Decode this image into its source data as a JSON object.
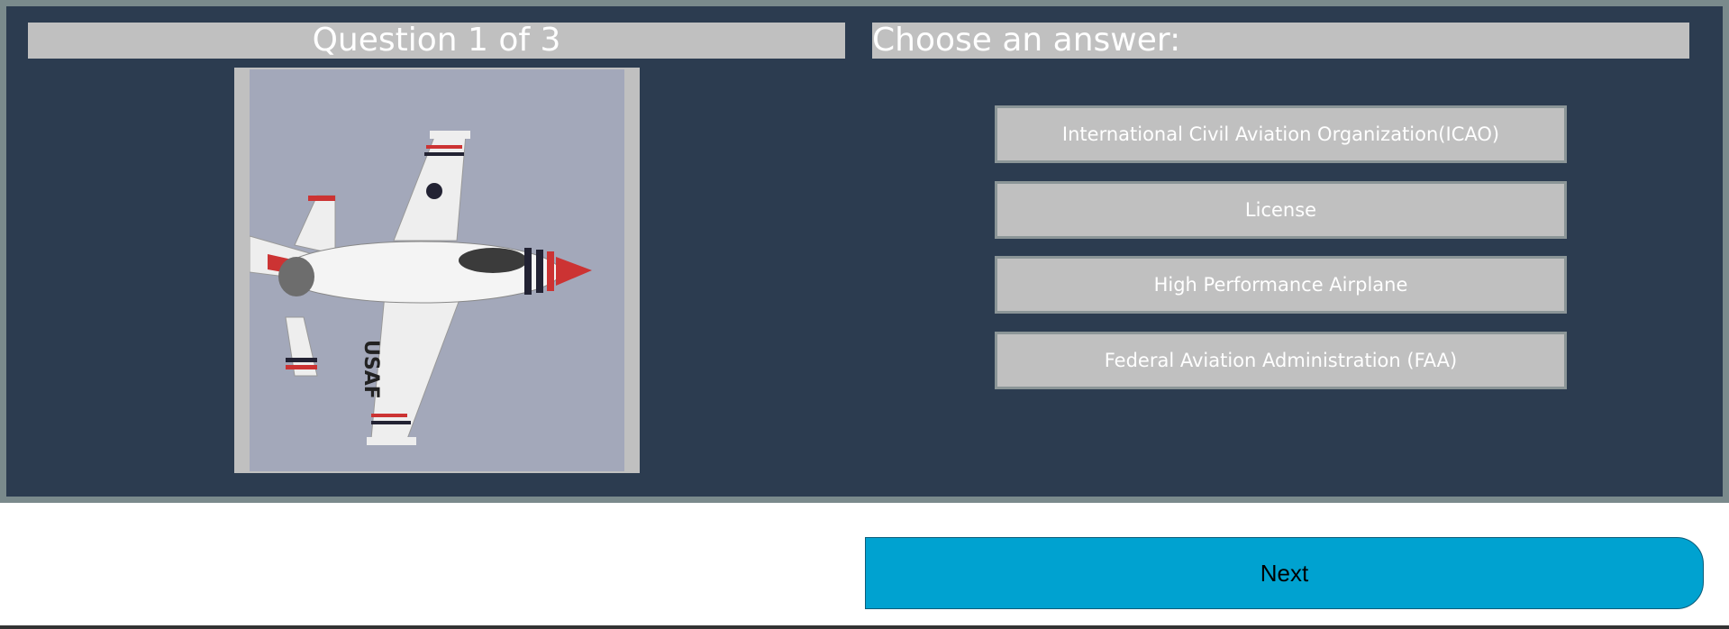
{
  "question": {
    "counter": "Question 1 of 3",
    "image": {
      "icon": "fighter-jet-image",
      "fuselage_text": "USAF"
    }
  },
  "answers": {
    "heading": "Choose an answer:",
    "options": [
      {
        "label": "International Civil Aviation Organization(ICAO)"
      },
      {
        "label": "License"
      },
      {
        "label": "High Performance Airplane"
      },
      {
        "label": "Federal Aviation Administration (FAA)"
      }
    ]
  },
  "navigation": {
    "next_label": "Next"
  },
  "colors": {
    "panel": "#2c3c50",
    "panel_border": "#7a8a8c",
    "option": "#c0c0c0",
    "next": "#00a2d0"
  }
}
